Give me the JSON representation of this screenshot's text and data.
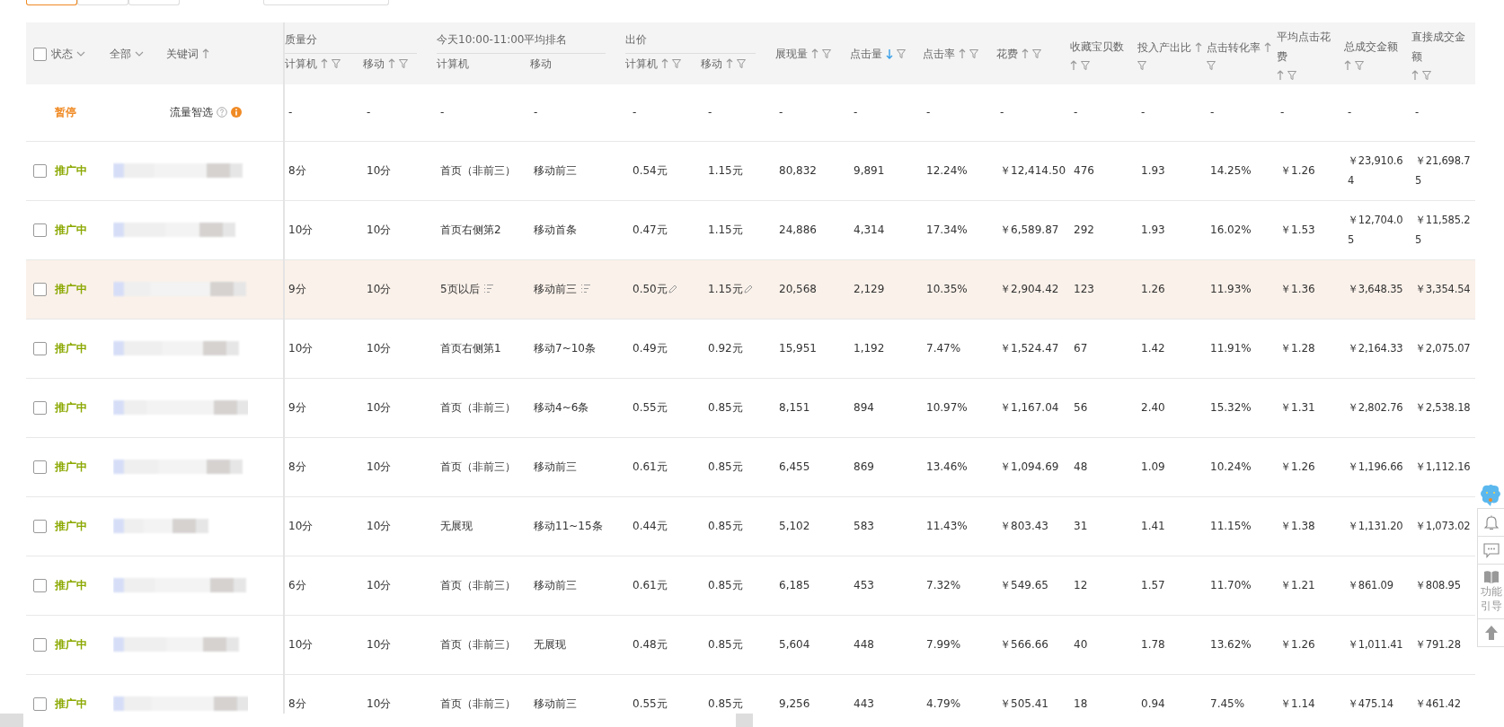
{
  "top_tabs": [
    {
      "selected": true
    },
    {
      "selected": false
    },
    {
      "selected": false
    }
  ],
  "table": {
    "select_all": {
      "checked": false
    },
    "header_left": [
      {
        "label": "状态",
        "kind": "dropdown"
      },
      {
        "label": "全部",
        "kind": "dropdown"
      },
      {
        "label": "关键词",
        "kind": "sortable"
      }
    ],
    "groups": [
      {
        "label": "质量分"
      },
      {
        "label": "今天10:00-11:00平均排名"
      },
      {
        "label": "出价"
      }
    ],
    "columns": [
      {
        "label": "计算机",
        "sortable": true,
        "sorted": false,
        "filter": true
      },
      {
        "label": "移动",
        "sortable": true,
        "sorted": false,
        "filter": true
      },
      {
        "label": "计算机",
        "sortable": false,
        "filter": false
      },
      {
        "label": "移动",
        "sortable": false,
        "filter": false
      },
      {
        "label": "计算机",
        "sortable": true,
        "sorted": false,
        "filter": true
      },
      {
        "label": "移动",
        "sortable": true,
        "sorted": false,
        "filter": true
      },
      {
        "label": "展现量",
        "sortable": true,
        "sorted": false,
        "filter": true
      },
      {
        "label": "点击量",
        "sortable": true,
        "sorted": true,
        "filter": true
      },
      {
        "label": "点击率",
        "sortable": true,
        "sorted": false,
        "filter": true
      },
      {
        "label": "花费",
        "sortable": true,
        "sorted": false,
        "filter": true
      },
      {
        "label": "收藏宝贝数",
        "sortable": true,
        "sorted": false,
        "filter": true
      },
      {
        "label": "投入产出比",
        "sortable": true,
        "sorted": false,
        "filter": true
      },
      {
        "label": "点击转化率",
        "sortable": true,
        "sorted": false,
        "filter": true
      },
      {
        "label": "平均点击花费",
        "sortable": true,
        "sorted": false,
        "filter": true
      },
      {
        "label": "总成交金额",
        "sortable": true,
        "sorted": false,
        "filter": true
      },
      {
        "label": "直接成交金额",
        "sortable": true,
        "sorted": false,
        "filter": true
      }
    ],
    "rows": [
      {
        "kind": "smart",
        "status": "暂停",
        "color": "#f08a24",
        "keyword": "流量智选",
        "hovered": false,
        "cells": [
          "-",
          "-",
          "-",
          "-",
          "-",
          "-",
          "-",
          "-",
          "-",
          "-",
          "-",
          "-",
          "-",
          "-",
          "-",
          "-"
        ]
      },
      {
        "kind": "keyword",
        "checked": false,
        "status": "推广中",
        "color": "#8aa800",
        "hovered": false,
        "cells": [
          "8分",
          "10分",
          "首页（非前三）",
          "移动前三",
          "0.54元",
          "1.15元",
          "80,832",
          "9,891",
          "12.24%",
          "￥12,414.50",
          "476",
          "1.93",
          "14.25%",
          "￥1.26",
          "￥23,910.64",
          "￥21,698.75"
        ]
      },
      {
        "kind": "keyword",
        "checked": false,
        "status": "推广中",
        "color": "#8aa800",
        "hovered": false,
        "cells": [
          "10分",
          "10分",
          "首页右侧第2",
          "移动首条",
          "0.47元",
          "1.15元",
          "24,886",
          "4,314",
          "17.34%",
          "￥6,589.87",
          "292",
          "1.93",
          "16.02%",
          "￥1.53",
          "￥12,704.05",
          "￥11,585.25"
        ]
      },
      {
        "kind": "keyword",
        "checked": false,
        "status": "推广中",
        "color": "#8aa800",
        "hovered": true,
        "cells": [
          "9分",
          "10分",
          "5页以后",
          "移动前三",
          "0.50元",
          "1.15元",
          "20,568",
          "2,129",
          "10.35%",
          "￥2,904.42",
          "123",
          "1.26",
          "11.93%",
          "￥1.36",
          "￥3,648.35",
          "￥3,354.54"
        ]
      },
      {
        "kind": "keyword",
        "checked": false,
        "status": "推广中",
        "color": "#8aa800",
        "hovered": false,
        "cells": [
          "10分",
          "10分",
          "首页右侧第1",
          "移动7~10条",
          "0.49元",
          "0.92元",
          "15,951",
          "1,192",
          "7.47%",
          "￥1,524.47",
          "67",
          "1.42",
          "11.91%",
          "￥1.28",
          "￥2,164.33",
          "￥2,075.07"
        ]
      },
      {
        "kind": "keyword",
        "checked": false,
        "status": "推广中",
        "color": "#8aa800",
        "hovered": false,
        "cells": [
          "9分",
          "10分",
          "首页（非前三）",
          "移动4~6条",
          "0.55元",
          "0.85元",
          "8,151",
          "894",
          "10.97%",
          "￥1,167.04",
          "56",
          "2.40",
          "15.32%",
          "￥1.31",
          "￥2,802.76",
          "￥2,538.18"
        ]
      },
      {
        "kind": "keyword",
        "checked": false,
        "status": "推广中",
        "color": "#8aa800",
        "hovered": false,
        "cells": [
          "8分",
          "10分",
          "首页（非前三）",
          "移动前三",
          "0.61元",
          "0.85元",
          "6,455",
          "869",
          "13.46%",
          "￥1,094.69",
          "48",
          "1.09",
          "10.24%",
          "￥1.26",
          "￥1,196.66",
          "￥1,112.16"
        ]
      },
      {
        "kind": "keyword",
        "checked": false,
        "status": "推广中",
        "color": "#8aa800",
        "hovered": false,
        "cells": [
          "10分",
          "10分",
          "无展现",
          "移动11~15条",
          "0.44元",
          "0.85元",
          "5,102",
          "583",
          "11.43%",
          "￥803.43",
          "31",
          "1.41",
          "11.15%",
          "￥1.38",
          "￥1,131.20",
          "￥1,073.02"
        ]
      },
      {
        "kind": "keyword",
        "checked": false,
        "status": "推广中",
        "color": "#8aa800",
        "hovered": false,
        "cells": [
          "6分",
          "10分",
          "首页（非前三）",
          "移动前三",
          "0.61元",
          "0.85元",
          "6,185",
          "453",
          "7.32%",
          "￥549.65",
          "12",
          "1.57",
          "11.70%",
          "￥1.21",
          "￥861.09",
          "￥808.95"
        ]
      },
      {
        "kind": "keyword",
        "checked": false,
        "status": "推广中",
        "color": "#8aa800",
        "hovered": false,
        "cells": [
          "10分",
          "10分",
          "首页（非前三）",
          "无展现",
          "0.48元",
          "0.85元",
          "5,604",
          "448",
          "7.99%",
          "￥566.66",
          "40",
          "1.78",
          "13.62%",
          "￥1.26",
          "￥1,011.41",
          "￥791.28"
        ]
      },
      {
        "kind": "keyword",
        "checked": false,
        "status": "推广中",
        "color": "#8aa800",
        "hovered": false,
        "cells": [
          "8分",
          "10分",
          "首页（非前三）",
          "移动前三",
          "0.55元",
          "0.85元",
          "9,256",
          "443",
          "4.79%",
          "￥505.41",
          "18",
          "0.94",
          "7.45%",
          "￥1.14",
          "￥475.14",
          "￥461.42"
        ]
      }
    ]
  },
  "side_toolbar": {
    "guide_label": "功能引导"
  }
}
